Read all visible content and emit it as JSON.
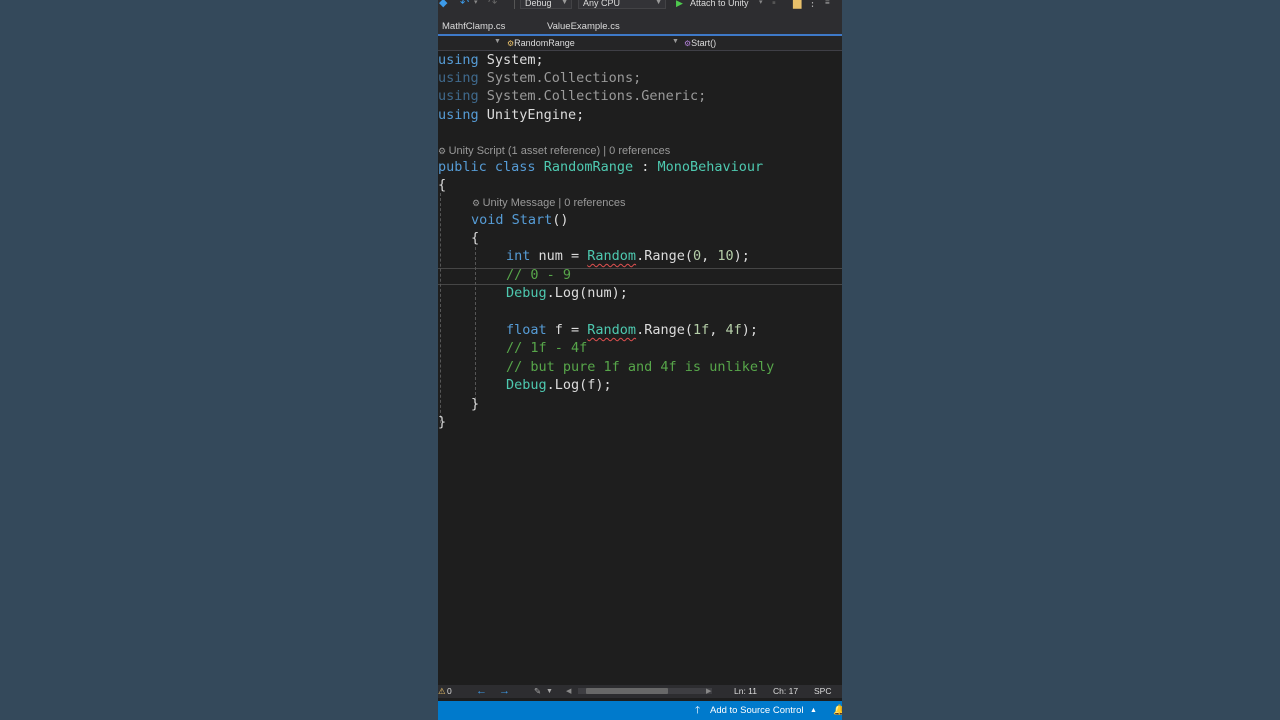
{
  "toolbar": {
    "configuration": "Debug",
    "platform": "Any CPU",
    "attach_label": "Attach to Unity",
    "icons": [
      "undo-icon",
      "redo-icon",
      "play-icon",
      "folder-icon",
      "more-icon"
    ]
  },
  "tabs": [
    {
      "label": "MathfClamp.cs"
    },
    {
      "label": "ValueExample.cs"
    }
  ],
  "navbar": {
    "class_name": "RandomRange",
    "member_name": "Start()"
  },
  "code": {
    "using1": {
      "kw": "using",
      "rest": " System;"
    },
    "using2": {
      "kw": "using",
      "rest": " System.Collections;"
    },
    "using3": {
      "kw": "using",
      "rest": " System.Collections.Generic;"
    },
    "using4": {
      "kw": "using",
      "rest": " UnityEngine;"
    },
    "class_lens": "Unity Script (1 asset reference) | 0 references",
    "class_decl": {
      "kw1": "public",
      "kw2": "class",
      "name": "RandomRange",
      "colon": " : ",
      "base": "MonoBehaviour"
    },
    "open_brace": "{",
    "method_lens": "Unity Message | 0 references",
    "method_decl": {
      "kw": "void",
      "name": "Start",
      "parens": "()"
    },
    "method_open": "{",
    "line_int": {
      "kw": "int",
      "var": " num = ",
      "cls": "Random",
      "call": ".Range(",
      "a": "0",
      "sep": ", ",
      "b": "10",
      "end": ");"
    },
    "comment1": "// 0 - 9",
    "log1": {
      "cls": "Debug",
      "call": ".Log(num);"
    },
    "line_float": {
      "kw": "float",
      "var": " f = ",
      "cls": "Random",
      "call": ".Range(",
      "a": "1f",
      "sep": ", ",
      "b": "4f",
      "end": ");"
    },
    "comment2": "// 1f - 4f",
    "comment3": "// but pure 1f and 4f is unlikely",
    "log2": {
      "cls": "Debug",
      "call": ".Log(f);"
    },
    "method_close": "}",
    "close_brace": "}"
  },
  "status": {
    "errors": "0",
    "line": "Ln: 11",
    "col": "Ch: 17",
    "mode": "SPC"
  },
  "bottom": {
    "source_control": "Add to Source Control"
  },
  "colors": {
    "keyword": "#569cd6",
    "type": "#4ec9b0",
    "comment": "#57a64a",
    "number": "#b5cea8",
    "accent": "#007acc"
  }
}
